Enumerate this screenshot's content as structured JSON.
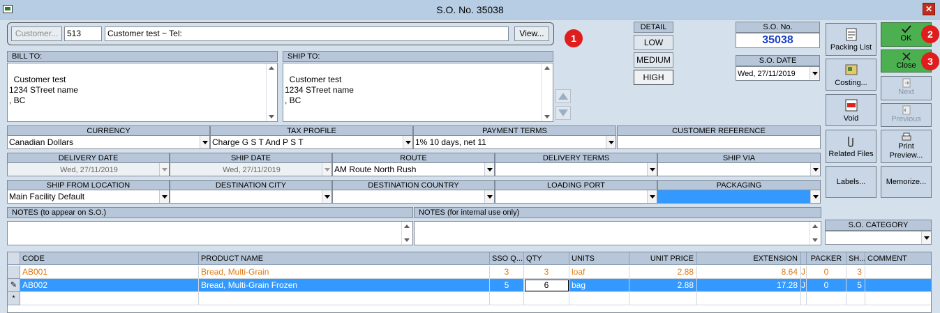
{
  "window": {
    "title": "S.O. No. 35038",
    "close_glyph": "✕"
  },
  "customer": {
    "button_label": "Customer...",
    "id": "513",
    "name_value": "Customer test  ~  Tel:",
    "view_label": "View..."
  },
  "badges": [
    "1",
    "2",
    "3"
  ],
  "detail": {
    "header": "DETAIL",
    "options": [
      "LOW",
      "MEDIUM",
      "HIGH"
    ],
    "selected": "HIGH"
  },
  "so_number": {
    "label": "S.O. No.",
    "value": "35038"
  },
  "so_date": {
    "label": "S.O. DATE",
    "value": "Wed, 27/11/2019"
  },
  "bill_to": {
    "label": "BILL TO:",
    "text": "Customer test\n1234 STreet name\n, BC"
  },
  "ship_to": {
    "label": "SHIP TO:",
    "text": "Customer test\n1234 STreet name\n, BC"
  },
  "fields_row1": [
    {
      "label": "CURRENCY",
      "value": "Canadian Dollars"
    },
    {
      "label": "TAX PROFILE",
      "value": "Charge G S T And P S T"
    },
    {
      "label": "PAYMENT TERMS",
      "value": "1% 10 days, net 11"
    },
    {
      "label": "CUSTOMER REFERENCE",
      "value": ""
    }
  ],
  "fields_row2": [
    {
      "label": "DELIVERY DATE",
      "value": "Wed, 27/11/2019"
    },
    {
      "label": "SHIP DATE",
      "value": "Wed, 27/11/2019"
    },
    {
      "label": "ROUTE",
      "value": "AM Route North Rush"
    },
    {
      "label": "DELIVERY TERMS",
      "value": ""
    },
    {
      "label": "SHIP VIA",
      "value": ""
    }
  ],
  "fields_row3": [
    {
      "label": "SHIP FROM LOCATION",
      "value": "Main Facility Default"
    },
    {
      "label": "DESTINATION CITY",
      "value": ""
    },
    {
      "label": "DESTINATION COUNTRY",
      "value": ""
    },
    {
      "label": "LOADING PORT",
      "value": ""
    },
    {
      "label": "PACKAGING",
      "value": ""
    }
  ],
  "notes": {
    "public_label": "NOTES (to appear on S.O.)",
    "internal_label": "NOTES (for internal use only)"
  },
  "so_category": {
    "label": "S.O. CATEGORY",
    "value": ""
  },
  "side_buttons": {
    "packing_list": "Packing List",
    "costing": "Costing...",
    "void": "Void",
    "related_files": "Related Files",
    "labels": "Labels...",
    "ok": "OK",
    "close": "Close",
    "next": "Next",
    "previous": "Previous",
    "print_preview_1": "Print",
    "print_preview_2": "Preview...",
    "memorize": "Memorize..."
  },
  "colors": {
    "accent_green": "#4caf50",
    "selection_blue": "#3399ff",
    "badge_red": "#e01d1d",
    "orange_text": "#e07a10"
  },
  "grid": {
    "columns": [
      "CODE",
      "PRODUCT NAME",
      "SSO Q...",
      "QTY",
      "UNITS",
      "UNIT PRICE",
      "EXTENSION",
      "",
      "PACKER",
      "SH...",
      "COMMENT"
    ],
    "rows": [
      {
        "code": "AB001",
        "name": "Bread, Multi-Grain",
        "sso_qty": "3",
        "qty": "3",
        "units": "loaf",
        "unit_price": "2.88",
        "extension": "8.64",
        "flag": "J",
        "packer": "0",
        "ship": "3",
        "comment": ""
      },
      {
        "code": "AB002",
        "name": "Bread, Multi-Grain Frozen",
        "sso_qty": "5",
        "qty": "6",
        "units": "bag",
        "unit_price": "2.88",
        "extension": "17.28",
        "flag": "J",
        "packer": "0",
        "ship": "5",
        "comment": ""
      }
    ],
    "new_row_glyph": "*",
    "edit_row_glyph": "✎"
  }
}
